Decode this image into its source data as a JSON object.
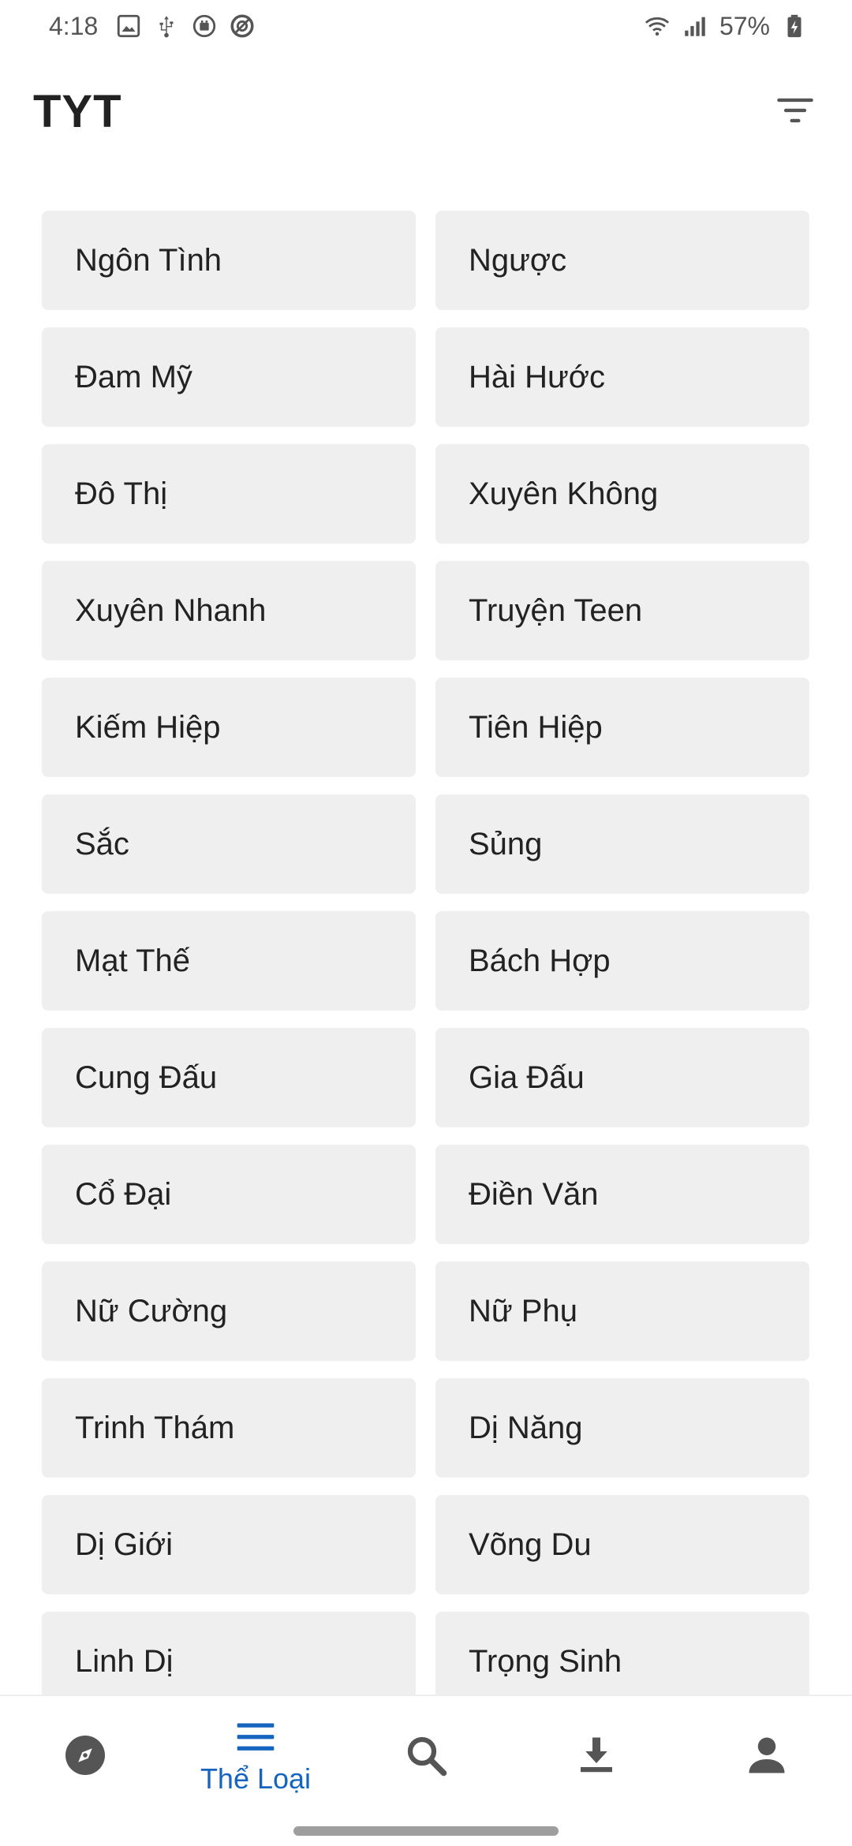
{
  "status_bar": {
    "time": "4:18",
    "battery": "57%"
  },
  "app_bar": {
    "title": "TYT"
  },
  "genres": [
    "Ngôn Tình",
    "Ngược",
    "Đam Mỹ",
    "Hài Hước",
    "Đô Thị",
    "Xuyên Không",
    "Xuyên Nhanh",
    "Truyện Teen",
    "Kiếm Hiệp",
    "Tiên Hiệp",
    "Sắc",
    "Sủng",
    "Mạt Thế",
    "Bách Hợp",
    "Cung Đấu",
    "Gia Đấu",
    "Cổ Đại",
    "Điền Văn",
    "Nữ Cường",
    "Nữ Phụ",
    "Trinh Thám",
    "Dị Năng",
    "Dị Giới",
    "Võng Du",
    "Linh Dị",
    "Trọng Sinh"
  ],
  "bottom_nav": {
    "active_label": "Thể Loại",
    "items": [
      {
        "icon": "compass-icon"
      },
      {
        "icon": "menu-lines-icon",
        "label": "Thể Loại",
        "active": true
      },
      {
        "icon": "search-icon"
      },
      {
        "icon": "download-icon"
      },
      {
        "icon": "person-icon"
      }
    ]
  },
  "colors": {
    "accent": "#1565c0",
    "tile_background": "#efefef",
    "text": "#222222",
    "icon": "#555555"
  }
}
